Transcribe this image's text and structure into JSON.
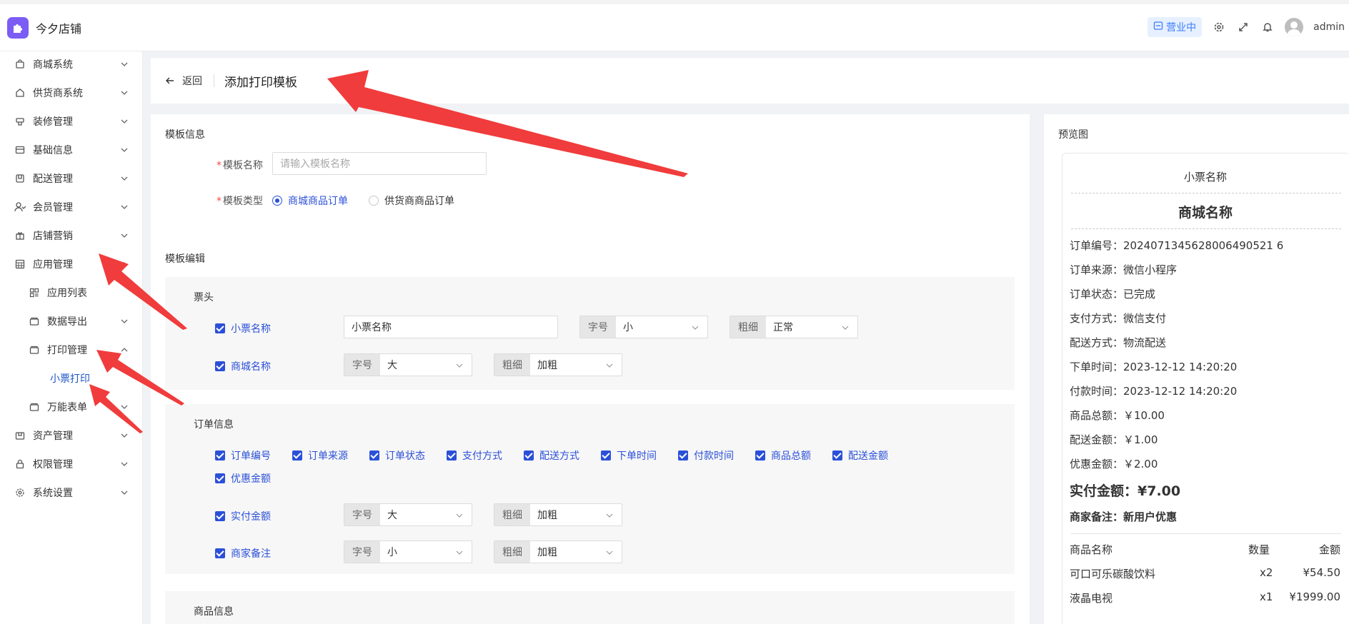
{
  "header": {
    "brand_name": "今夕店铺",
    "status": "营业中",
    "user": "admin"
  },
  "sidebar": {
    "items": [
      {
        "label": "商城系统",
        "icon": "bag-icon"
      },
      {
        "label": "供货商系统",
        "icon": "house-icon"
      },
      {
        "label": "装修管理",
        "icon": "paint-icon"
      },
      {
        "label": "基础信息",
        "icon": "card-icon"
      },
      {
        "label": "配送管理",
        "icon": "box-icon"
      },
      {
        "label": "会员管理",
        "icon": "user-icon"
      },
      {
        "label": "店铺营销",
        "icon": "gift-icon"
      },
      {
        "label": "应用管理",
        "icon": "grid-icon"
      },
      {
        "label": "应用列表",
        "icon": "apps-icon"
      },
      {
        "label": "数据导出",
        "icon": "folder-icon"
      },
      {
        "label": "打印管理",
        "icon": "folder-icon"
      },
      {
        "label": "小票打印",
        "icon": ""
      },
      {
        "label": "万能表单",
        "icon": "folder-icon"
      },
      {
        "label": "资产管理",
        "icon": "wallet-icon"
      },
      {
        "label": "权限管理",
        "icon": "lock-icon"
      },
      {
        "label": "系统设置",
        "icon": "gear-icon"
      }
    ]
  },
  "titlebar": {
    "back_label": "返回",
    "title": "添加打印模板"
  },
  "form": {
    "section_info": "模板信息",
    "name_label": "模板名称",
    "name_placeholder": "请输入模板名称",
    "type_label": "模板类型",
    "type_options": [
      "商城商品订单",
      "供货商商品订单"
    ],
    "section_edit": "模板编辑"
  },
  "ticket_head": {
    "title": "票头",
    "small_name_label": "小票名称",
    "small_name_value": "小票名称",
    "mall_name_label": "商城名称"
  },
  "selects": {
    "size_label": "字号",
    "weight_label": "粗细",
    "small": "小",
    "large": "大",
    "normal": "正常",
    "bold": "加粗"
  },
  "order_info": {
    "title": "订单信息",
    "checks": [
      "订单编号",
      "订单来源",
      "订单状态",
      "支付方式",
      "配送方式",
      "下单时间",
      "付款时间",
      "商品总额",
      "配送金额",
      "优惠金额"
    ],
    "paid_label": "实付金额",
    "remark_label": "商家备注"
  },
  "goods_info": {
    "title": "商品信息"
  },
  "preview": {
    "label": "预览图",
    "ticket_name": "小票名称",
    "mall_name": "商城名称",
    "lines": [
      "订单编号：2024071345628006490521 6",
      "订单来源：微信小程序",
      "订单状态：已完成",
      "支付方式：微信支付",
      "配送方式：物流配送",
      "下单时间：2023-12-12 14:20:20",
      "付款时间：2023-12-12 14:20:20",
      "商品总额：￥10.00",
      "配送金额：￥1.00",
      "优惠金额：￥2.00"
    ],
    "paid": "实付金额：¥7.00",
    "remark": "商家备注：新用户优惠",
    "goods_headers": [
      "商品名称",
      "数量",
      "金额"
    ],
    "goods": [
      {
        "name": "可口可乐碳酸饮料",
        "qty": "x2",
        "amount": "¥54.50"
      },
      {
        "name": "液晶电视",
        "qty": "x1",
        "amount": "¥1999.00"
      }
    ]
  },
  "colors": {
    "accent": "#2b50d8",
    "logo": "#7b5cf5",
    "annotation_arrow": "#f03c3c"
  }
}
